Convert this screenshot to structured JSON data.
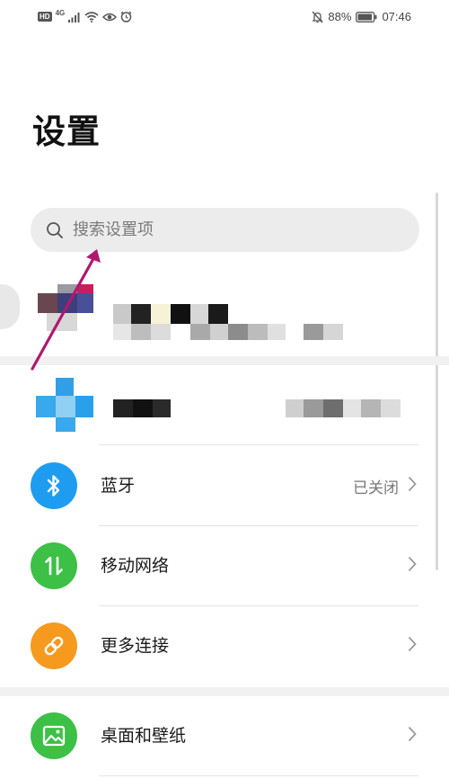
{
  "status_bar": {
    "hd": "HD",
    "network": "4G",
    "battery_percent": "88%",
    "time": "07:46",
    "icons": [
      "signal-icon",
      "wifi-icon",
      "eye-icon",
      "alarm-icon",
      "mute-icon",
      "battery-icon"
    ]
  },
  "page": {
    "title": "设置"
  },
  "search": {
    "placeholder": "搜索设置项",
    "icon": "search-icon"
  },
  "settings": [
    {
      "label": "蓝牙",
      "value": "已关闭",
      "icon": "bluetooth-icon",
      "color": "#1e9df0"
    },
    {
      "label": "移动网络",
      "value": "",
      "icon": "mobile-network-icon",
      "color": "#3cc046"
    },
    {
      "label": "更多连接",
      "value": "",
      "icon": "link-icon",
      "color": "#f59a1e"
    },
    {
      "label": "桌面和壁纸",
      "value": "",
      "icon": "wallpaper-icon",
      "color": "#3cc046"
    }
  ],
  "annotation": {
    "color": "#b0186e"
  }
}
